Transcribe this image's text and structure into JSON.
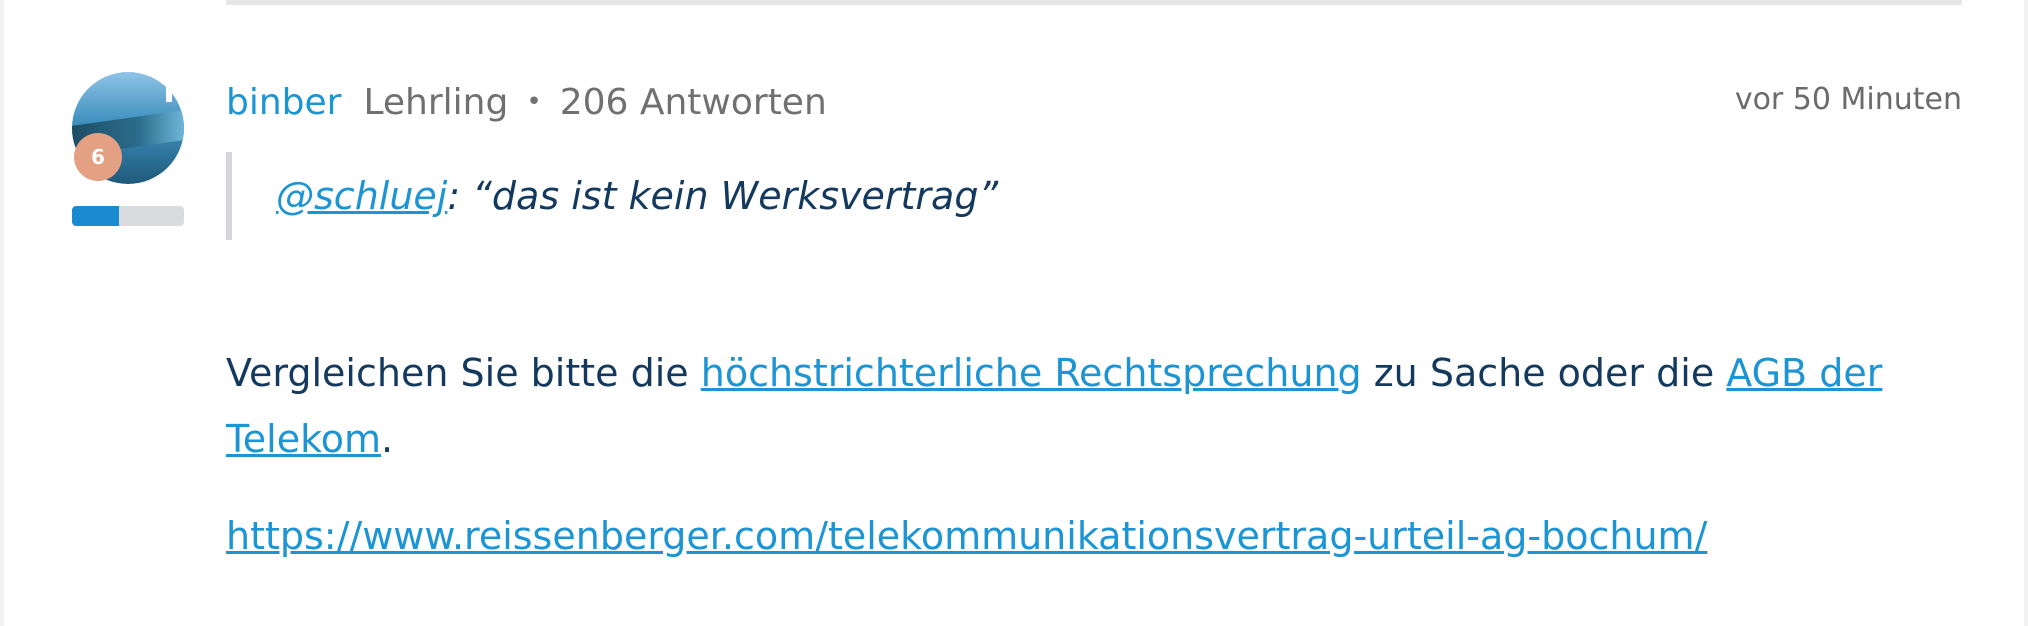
{
  "post": {
    "author": {
      "name": "binber",
      "rank": "Lehrling",
      "separator": "•",
      "answers": "206 Antworten",
      "level_badge": "6",
      "rank_progress": 0.42,
      "avatar_icon": "avatar-image"
    },
    "timestamp": "vor 50 Minuten",
    "quote": {
      "mention": "@schluej",
      "text": ": “das ist kein Werksvertrag”"
    },
    "body": {
      "part1": "Vergleichen Sie bitte die ",
      "link1": "höchstrichterliche Rechtsprechung",
      "part2": " zu Sache oder die ",
      "link2": "AGB der Telekom",
      "part3": "."
    },
    "url": "https://www.reissenberger.com/telekommunikationsvertrag-urteil-ag-bochum/"
  },
  "colors": {
    "link": "#1d94d3",
    "text": "#13395e",
    "muted": "#707070",
    "rank_fill": "#1a8bd1",
    "badge": "#e3a083"
  }
}
